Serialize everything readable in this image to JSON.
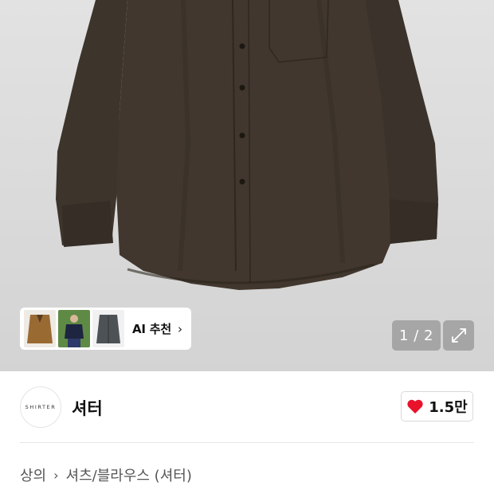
{
  "gallery": {
    "counter": "1 / 2",
    "ai_recommend_label": "AI 추천",
    "ai_chevron": "›",
    "expand_icon": "expand-icon"
  },
  "brand": {
    "logo_text": "SHIRTER",
    "name": "셔터",
    "likes": "1.5만",
    "heart_color": "#e8132b"
  },
  "breadcrumb": {
    "category": "상의",
    "separator": "›",
    "subcategory": "셔츠/블라우스 (셔터)"
  }
}
